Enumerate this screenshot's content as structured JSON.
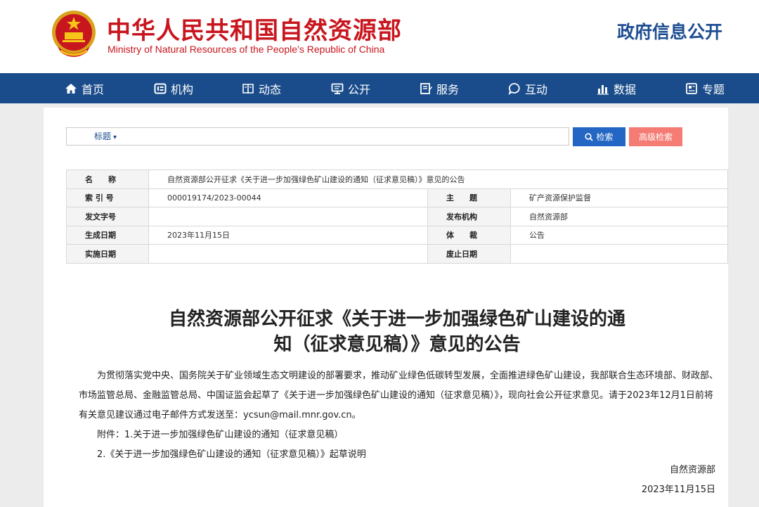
{
  "header": {
    "title_cn": "中华人民共和国自然资源部",
    "title_en": "Ministry of Natural Resources of the People’s Republic of China",
    "right_label": "政府信息公开",
    "colors": {
      "brand_red": "#c8161e",
      "nav_blue": "#1a4c8b"
    }
  },
  "nav": {
    "items": [
      {
        "label": "首页",
        "icon": "home-icon"
      },
      {
        "label": "机构",
        "icon": "org-icon"
      },
      {
        "label": "动态",
        "icon": "news-icon"
      },
      {
        "label": "公开",
        "icon": "disclosure-icon"
      },
      {
        "label": "服务",
        "icon": "service-icon"
      },
      {
        "label": "互动",
        "icon": "interact-icon"
      },
      {
        "label": "数据",
        "icon": "data-icon"
      },
      {
        "label": "专题",
        "icon": "topic-icon"
      }
    ]
  },
  "search": {
    "scope": "标题",
    "value": "",
    "search_label": "检索",
    "advanced_label": "高级检索"
  },
  "info": {
    "name_label": "名　　称",
    "name_value": "自然资源部公开征求《关于进一步加强绿色矿山建设的通知（征求意见稿）》意见的公告",
    "index_label": "索 引 号",
    "index_value": "000019174/2023-00044",
    "subject_label": "主　　题",
    "subject_value": "矿产资源保护监督",
    "docno_label": "发文字号",
    "docno_value": "",
    "issuer_label": "发布机构",
    "issuer_value": "自然资源部",
    "created_label": "生成日期",
    "created_value": "2023年11月15日",
    "genre_label": "体　　裁",
    "genre_value": "公告",
    "effective_label": "实施日期",
    "effective_value": "",
    "repeal_label": "废止日期",
    "repeal_value": ""
  },
  "article": {
    "title_line1": "自然资源部公开征求《关于进一步加强绿色矿山建设的通",
    "title_line2": "知（征求意见稿）》意见的公告",
    "para1": "为贯彻落实党中央、国务院关于矿业领域生态文明建设的部署要求，推动矿业绿色低碳转型发展，全面推进绿色矿山建设，我部联合生态环境部、财政部、市场监管总局、金融监管总局、中国证监会起草了《关于进一步加强绿色矿山建设的通知（征求意见稿）》，现向社会公开征求意见。请于2023年12月1日前将有关意见建议通过电子邮件方式发送至：ycsun@mail.mnr.gov.cn。",
    "attachment1": "附件：1.关于进一步加强绿色矿山建设的通知（征求意见稿）",
    "attachment2": "2.《关于进一步加强绿色矿山建设的通知（征求意见稿）》起草说明",
    "signer": "自然资源部",
    "date": "2023年11月15日"
  }
}
